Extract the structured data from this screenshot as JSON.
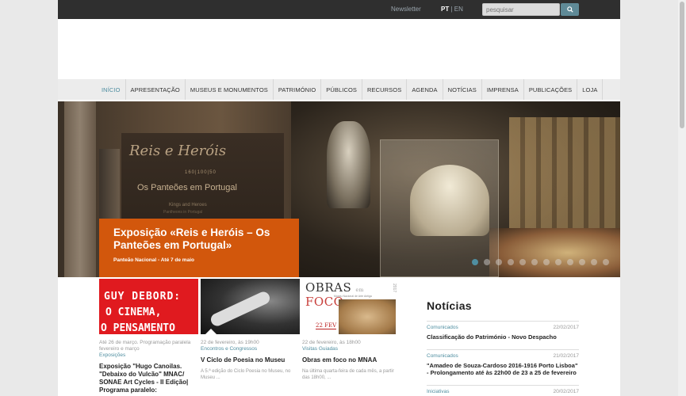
{
  "topbar": {
    "newsletter": "Newsletter",
    "lang_active": "PT",
    "lang_sep": " | ",
    "lang_other": "EN",
    "search_placeholder": "pesquisar"
  },
  "nav": {
    "items": [
      "INÍCIO",
      "APRESENTAÇÃO",
      "MUSEUS E MONUMENTOS",
      "PATRIMÓNIO",
      "PÚBLICOS",
      "RECURSOS",
      "AGENDA",
      "NOTÍCIAS",
      "IMPRENSA",
      "PUBLICAÇÕES",
      "LOJA"
    ]
  },
  "hero": {
    "banner_script": "Reis e Heróis",
    "banner_years": "160|100|50",
    "banner_title": "Os Panteões em Portugal",
    "banner_en": "Kings and Heroes",
    "banner_en_sub": "Pantheons in Portugal",
    "caption_title": "Exposição «Reis e Heróis – Os Panteões em Portugal»",
    "caption_sub": "Panteão Nacional - Até 7 de maio",
    "dots_count": 12,
    "active_dot": 0
  },
  "cards": [
    {
      "img_lines": [
        "GUY DEBORD:",
        "O CINEMA,",
        "O PENSAMENTO"
      ],
      "meta": "Até 26 de março. Programação paralela fevereiro e março",
      "category": "Exposições",
      "title": "Exposição \"Hugo Canoilas. \"Debaixo do Vulcão\" MNAC/ SONAE Art Cycles - II Edição| Programa paralelo:",
      "desc": ""
    },
    {
      "meta": "22 de fevereiro, às 19h00",
      "category": "Encontros e Congressos",
      "title": "V Ciclo de Poesia no Museu",
      "desc": "A 5.ª edição do Ciclo Poesia no Museu, no Museu ..."
    },
    {
      "img_header_a": "OBRAS",
      "img_header_b": "FOCO",
      "img_header_em": "em",
      "img_year": "2017",
      "img_sub": "Museu Nacional de Arte Antiga",
      "img_date": "22 FEV",
      "meta": "22 de fevereiro, às 18h00",
      "category": "Visitas Guiadas",
      "title": "Obras em foco no MNAA",
      "desc": "Na última quarta-feira de cada mês, a partir das 18h00, ..."
    }
  ],
  "news": {
    "heading": "Notícias",
    "items": [
      {
        "category": "Comunicados",
        "date": "22/02/2017",
        "title": "Classificação do Património - Novo Despacho"
      },
      {
        "category": "Comunicados",
        "date": "21/02/2017",
        "title": "\"Amadeo de Souza-Cardoso 2016-1916 Porto Lisboa\" - Prolongamento até às 22h00 de 23 a 25 de fevereiro"
      },
      {
        "category": "Iniciativas",
        "date": "20/02/2017",
        "title": ""
      }
    ]
  },
  "colors": {
    "accent": "#4f8ea0",
    "caption_bg": "#d2570c",
    "topbar_bg": "#2f2f2f"
  }
}
